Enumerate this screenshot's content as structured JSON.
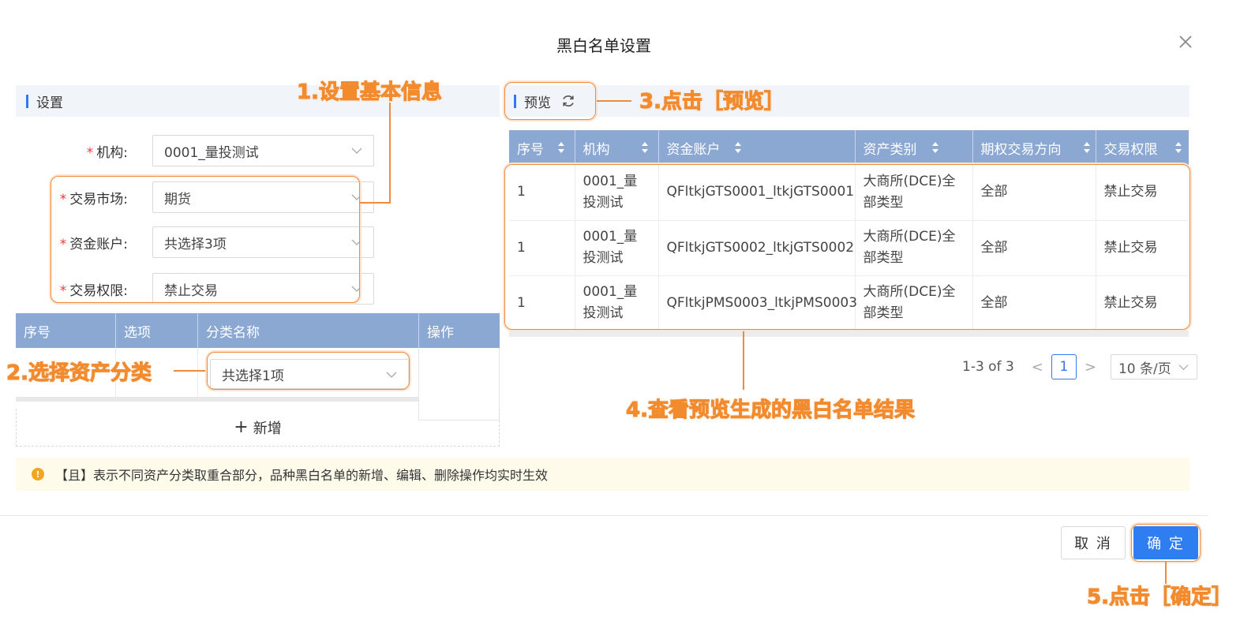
{
  "dialog": {
    "title": "黑白名单设置",
    "close_icon": "close-icon"
  },
  "settings": {
    "header": "设置",
    "fields": [
      {
        "label": "机构:",
        "value": "0001_量投测试"
      },
      {
        "label": "交易市场:",
        "value": "期货"
      },
      {
        "label": "资金账户:",
        "value": "共选择3项"
      },
      {
        "label": "交易权限:",
        "value": "禁止交易"
      }
    ],
    "required_mark": "*"
  },
  "category_table": {
    "headers": [
      "序号",
      "选项",
      "分类名称",
      "操作"
    ],
    "row": {
      "category_value": "共选择1项"
    },
    "add_label": "新增",
    "add_icon": "+"
  },
  "preview": {
    "header": "预览",
    "columns": [
      "序号",
      "机构",
      "资金账户",
      "资产类别",
      "期权交易方向",
      "交易权限"
    ],
    "rows": [
      {
        "index": "1",
        "org": "0001_量投测试",
        "account": "QFltkjGTS0001_ltkjGTS0001",
        "asset": "大商所(DCE)全部类型",
        "direction": "全部",
        "permission": "禁止交易"
      },
      {
        "index": "1",
        "org": "0001_量投测试",
        "account": "QFltkjGTS0002_ltkjGTS0002",
        "asset": "大商所(DCE)全部类型",
        "direction": "全部",
        "permission": "禁止交易"
      },
      {
        "index": "1",
        "org": "0001_量投测试",
        "account": "QFltkjPMS0003_ltkjPMS0003",
        "asset": "大商所(DCE)全部类型",
        "direction": "全部",
        "permission": "禁止交易"
      }
    ],
    "pagination": {
      "range": "1-3 of 3",
      "current_page": "1",
      "page_size": "10 条/页",
      "prev": "<",
      "next": ">"
    }
  },
  "notice": {
    "icon": "!",
    "text": "【且】表示不同资产分类取重合部分，品种黑白名单的新增、编辑、删除操作均实时生效"
  },
  "footer": {
    "cancel_label": "取 消",
    "ok_label": "确 定"
  },
  "annotations": {
    "step1": "1.设置基本信息",
    "step2": "2.选择资产分类",
    "step3": "3.点击［预览］",
    "step4": "4.查看预览生成的黑白名单结果",
    "step5": "5.点击［确定］",
    "accent_color": "#f08a3c"
  },
  "colors": {
    "table_header": "#8ba8d3",
    "primary": "#2f7ef1",
    "required": "#f5363a",
    "notice_bg": "#fffbeb"
  }
}
